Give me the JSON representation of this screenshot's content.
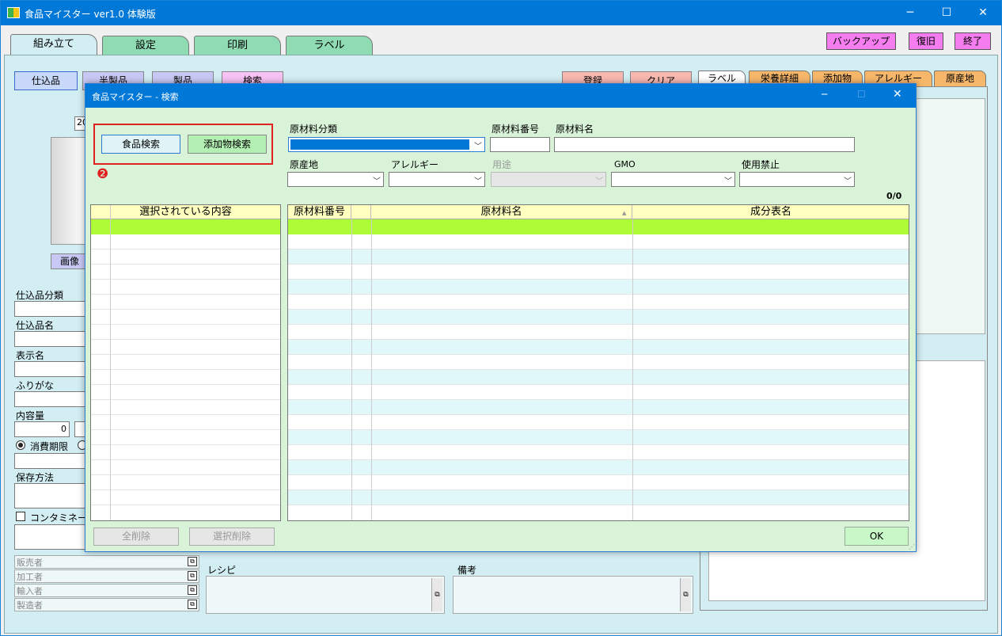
{
  "app": {
    "title": "食品マイスター ver1.0 体験版",
    "minimize": "─",
    "maximize": "☐",
    "close": "✕"
  },
  "tabs": [
    "組み立て",
    "設定",
    "印刷",
    "ラベル"
  ],
  "top_buttons": {
    "backup": "バックアップ",
    "restore": "復旧",
    "exit": "終了"
  },
  "category_buttons": {
    "shikomi": "仕込品",
    "hanseihin": "半製品",
    "seihin": "製品",
    "search": "検索"
  },
  "action_buttons": {
    "register": "登録",
    "clear": "クリア"
  },
  "right_tabs": [
    "ラベル",
    "栄養詳細",
    "添加物",
    "アレルギー",
    "原産地"
  ],
  "left_panel": {
    "date_prefix": "20",
    "image_button": "画像",
    "fields": [
      "仕込品分類",
      "仕込品名",
      "表示名",
      "ふりがな",
      "内容量"
    ],
    "quantity_value": "0",
    "radio_label": "消費期限",
    "storage_label": "保存方法",
    "contamination_label": "コンタミネーシ",
    "parties": [
      "販売者",
      "加工者",
      "輸入者",
      "製造者"
    ],
    "recipe_label": "レシピ",
    "notes_label": "備考"
  },
  "dialog": {
    "title": "食品マイスター - 検索",
    "food_search": "食品検索",
    "additive_search": "添加物検索",
    "step_marker": "❷",
    "filters": {
      "category": "原材料分類",
      "material_no": "原材料番号",
      "material_name": "原材料名",
      "origin": "原産地",
      "allergy": "アレルギー",
      "usage": "用途",
      "gmo": "GMO",
      "prohibited": "使用禁止"
    },
    "count": "0/0",
    "selected_header": "選択されている内容",
    "columns": [
      "原材料番号",
      "原材料名",
      "成分表名"
    ],
    "sort_indicator": "▲",
    "delete_all": "全削除",
    "delete_selected": "選択削除",
    "ok": "OK"
  },
  "colors": {
    "titlebar": "#0078d7",
    "main_bg": "#d2eef3",
    "dialog_bg": "#d9f3d9",
    "header_yellow": "#ffffc0",
    "selected_row": "#aefc36",
    "stripe": "#e0f8fa"
  }
}
